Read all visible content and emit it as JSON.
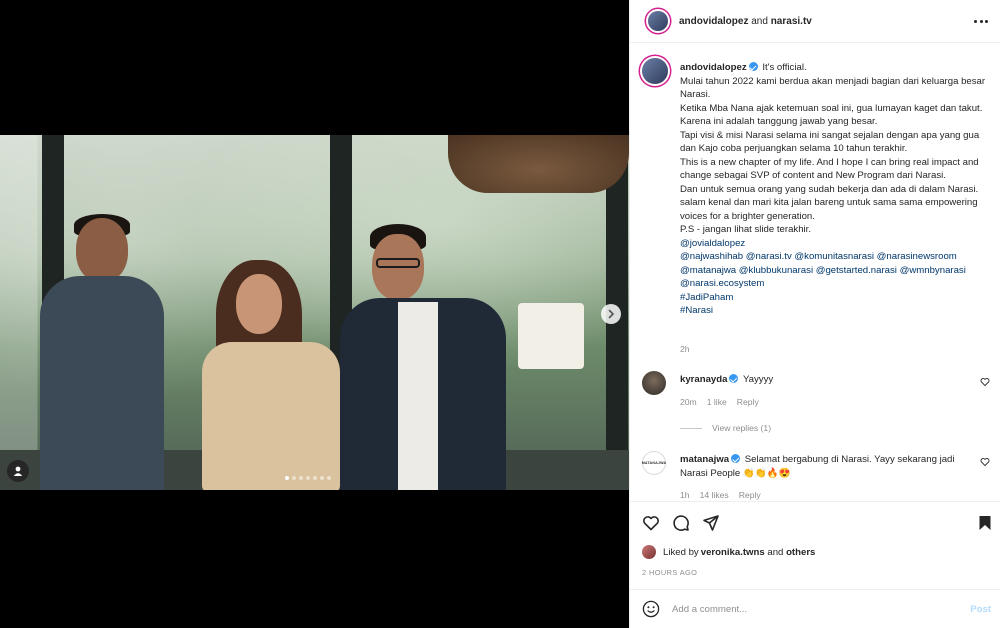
{
  "header": {
    "username": "andovidalopez",
    "and": " and ",
    "collaborator": "narasi.tv",
    "more_icon": "more-horizontal-icon"
  },
  "caption": {
    "username": "andovidalopez",
    "verified": true,
    "lines": [
      "It's official.",
      "Mulai tahun 2022 kami berdua akan menjadi bagian dari keluarga besar Narasi.",
      "Ketika Mba Nana ajak ketemuan soal ini, gua lumayan kaget dan takut.",
      "Karena ini adalah tanggung jawab yang besar.",
      "Tapi visi & misi Narasi selama ini sangat sejalan dengan apa yang gua dan Kajo coba perjuangkan selama 10 tahun terakhir.",
      "This is a new chapter of my life. And I hope I can bring real impact and change sebagai SVP of content and New Program dari Narasi.",
      "Dan untuk semua orang yang sudah bekerja dan ada di dalam Narasi. salam kenal dan mari kita jalan bareng untuk sama sama empowering voices for a brighter generation.",
      "P.S - jangan lihat slide terakhir."
    ],
    "mention_lines": [
      "@jovialdalopez",
      "@najwashihab @narasi.tv @komunitasnarasi @narasinewsroom",
      "@matanajwa @klubbukunarasi @getstarted.narasi @wmnbynarasi",
      "@narasi.ecosystem",
      "#JadiPaham",
      "#Narasi"
    ],
    "time": "2h"
  },
  "comments": [
    {
      "username": "kyranayda",
      "verified": true,
      "text": "Yayyyy",
      "time": "20m",
      "likes": "1 like",
      "reply": "Reply",
      "view_replies": "View replies (1)"
    },
    {
      "username": "matanajwa",
      "verified": true,
      "text": "Selamat bergabung di Narasi. Yayy sekarang jadi Narasi People 👏👏🔥😍",
      "time": "1h",
      "likes": "14 likes",
      "reply": "Reply",
      "avatar_text": "MATANAJWA"
    }
  ],
  "actions": {
    "liked_prefix": "Liked by ",
    "liked_user": "veronika.twns",
    "liked_and": " and ",
    "liked_others": "others",
    "timestamp": "2 HOURS AGO"
  },
  "add_comment": {
    "placeholder": "Add a comment...",
    "post_label": "Post"
  },
  "carousel": {
    "slide_count": 7,
    "active_index": 0
  },
  "colors": {
    "verified": "#3897f0",
    "link": "#00376b",
    "muted": "#8e8e8e",
    "post_disabled": "#b3dbff"
  }
}
